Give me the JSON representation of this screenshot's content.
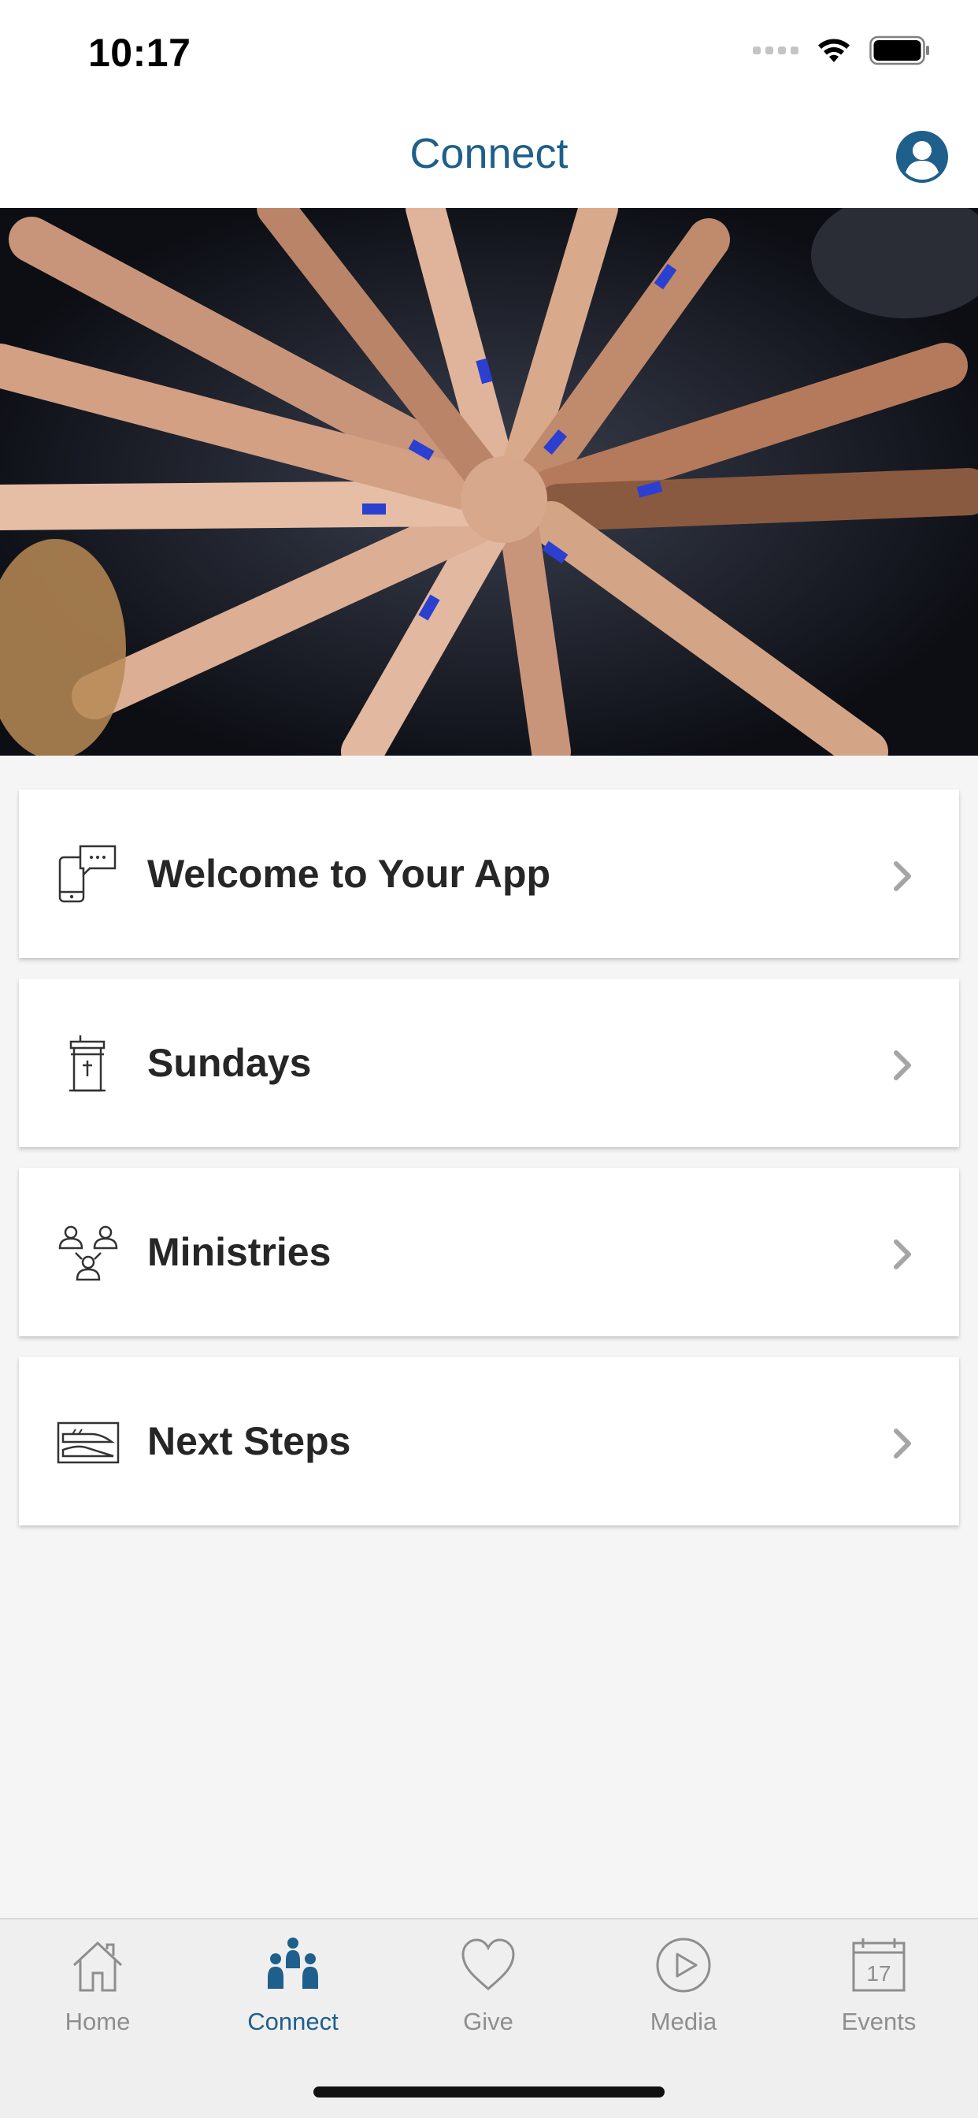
{
  "status_bar": {
    "time": "10:17"
  },
  "header": {
    "title": "Connect"
  },
  "menu": {
    "items": [
      {
        "label": "Welcome to Your App",
        "icon": "phone-chat-icon"
      },
      {
        "label": "Sundays",
        "icon": "pulpit-icon"
      },
      {
        "label": "Ministries",
        "icon": "people-group-icon"
      },
      {
        "label": "Next Steps",
        "icon": "shoes-step-icon"
      }
    ]
  },
  "tabs": [
    {
      "label": "Home",
      "icon": "home-icon",
      "active": false
    },
    {
      "label": "Connect",
      "icon": "people-icon",
      "active": true
    },
    {
      "label": "Give",
      "icon": "heart-icon",
      "active": false
    },
    {
      "label": "Media",
      "icon": "play-icon",
      "active": false
    },
    {
      "label": "Events",
      "icon": "calendar-icon",
      "active": false,
      "day": "17"
    }
  ],
  "colors": {
    "accent": "#1f5f8b",
    "tab_inactive": "#8e8e8e",
    "background": "#f5f5f5",
    "wristband_blue": "#2b3fd0"
  }
}
